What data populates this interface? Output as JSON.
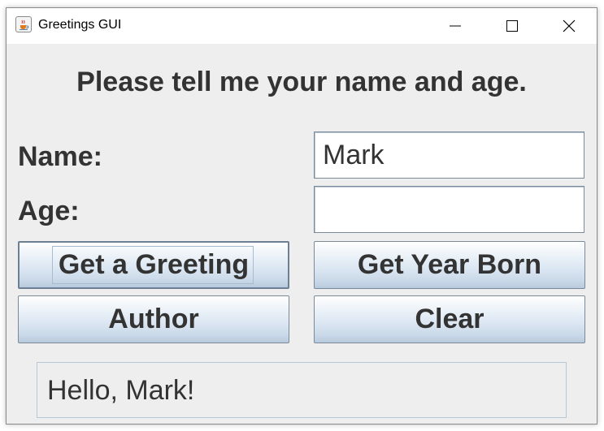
{
  "window": {
    "title": "Greetings GUI",
    "icon": "java-cup-icon",
    "controls": {
      "minimize": "minimize-icon",
      "maximize": "maximize-icon",
      "close": "close-icon"
    }
  },
  "main": {
    "prompt": "Please tell me your name and age.",
    "name_label": "Name:",
    "name_value": "Mark",
    "age_label": "Age:",
    "age_value": ""
  },
  "buttons": {
    "greeting": "Get a Greeting",
    "year_born": "Get Year Born",
    "author": "Author",
    "clear": "Clear"
  },
  "output": {
    "text": "Hello, Mark!"
  },
  "colors": {
    "background": "#eeeeee",
    "text": "#333333",
    "button_gradient_top": "#ffffff",
    "button_gradient_bottom": "#b8cadd",
    "border": "#7a8a99"
  }
}
